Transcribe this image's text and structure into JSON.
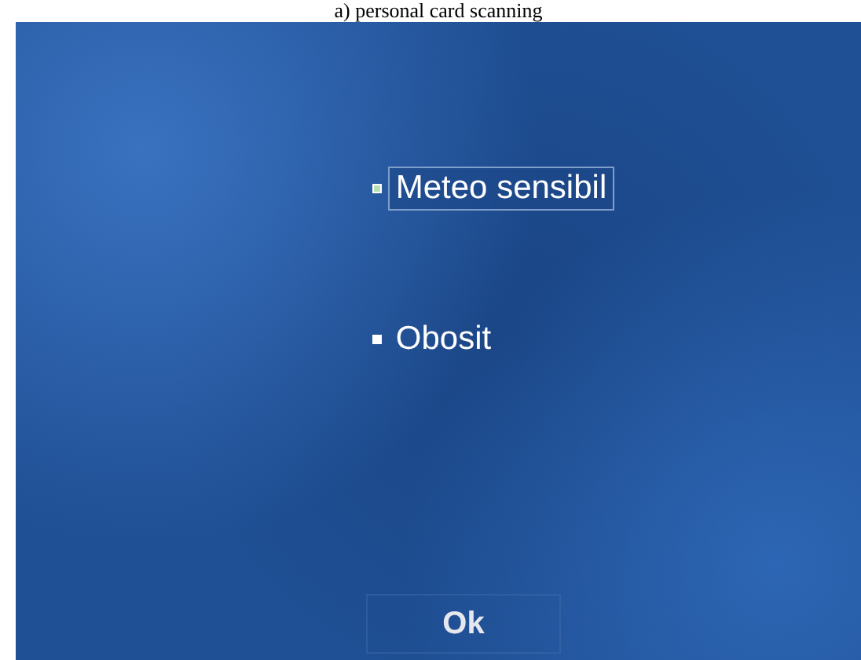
{
  "caption": "a) personal card scanning",
  "options": [
    {
      "label": "Meteo sensibil",
      "selected": true
    },
    {
      "label": "Obosit",
      "selected": false
    }
  ],
  "button": "Ok"
}
